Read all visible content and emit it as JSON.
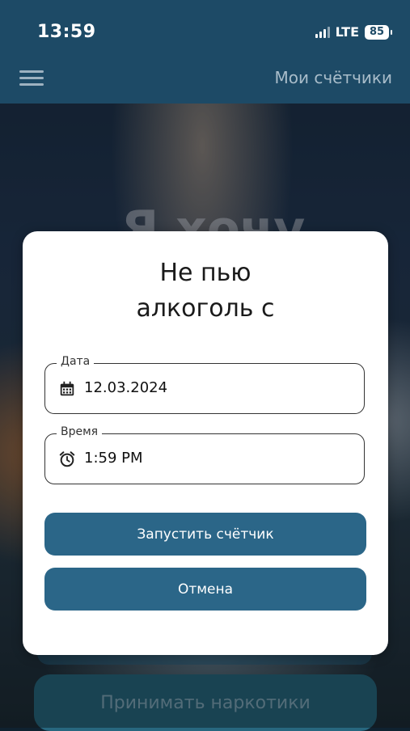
{
  "status_bar": {
    "time": "13:59",
    "network": "LTE",
    "battery": "85"
  },
  "app_bar": {
    "title": "Мои счётчики",
    "menu_icon": "hamburger-menu-icon"
  },
  "background": {
    "headline": "Я хочу",
    "bottom_button_label": "Принимать наркотики"
  },
  "modal": {
    "title_line1": "Не пью",
    "title_line2": "алкоголь с",
    "date_field": {
      "label": "Дата",
      "value": "12.03.2024",
      "icon": "calendar-icon"
    },
    "time_field": {
      "label": "Время",
      "value": "1:59 PM",
      "icon": "alarm-clock-icon"
    },
    "start_button_label": "Запустить счётчик",
    "cancel_button_label": "Отмена"
  },
  "colors": {
    "primary": "#2b6688",
    "app_bar": "#1d4a66"
  }
}
